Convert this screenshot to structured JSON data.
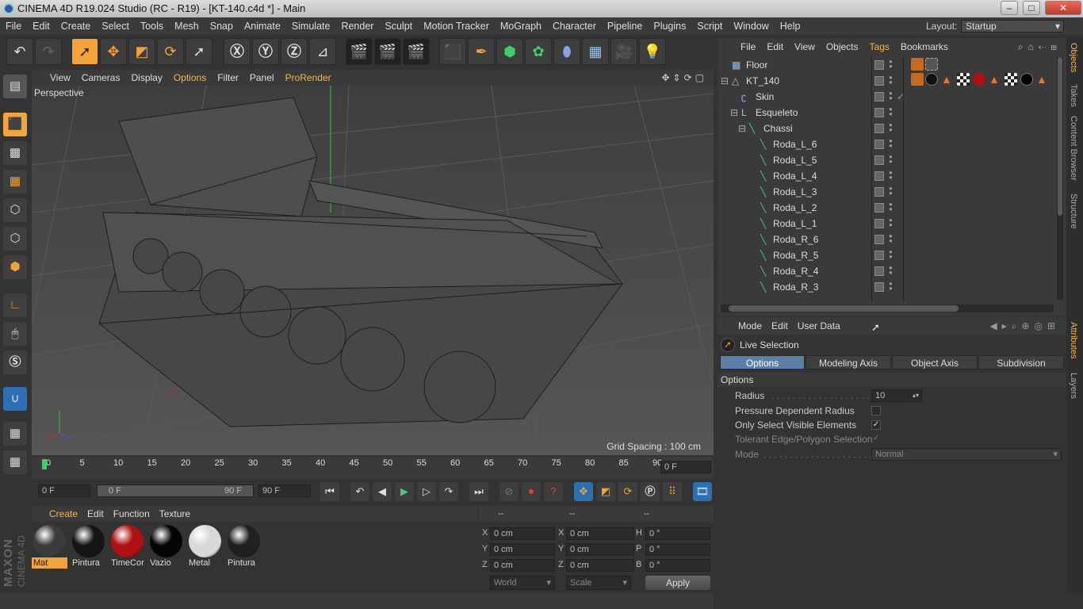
{
  "window": {
    "title": "CINEMA 4D R19.024 Studio (RC - R19) - [KT-140.c4d *] - Main",
    "minimize": "–",
    "maximize": "□",
    "close": "✕"
  },
  "menubar": {
    "items": [
      "File",
      "Edit",
      "Create",
      "Select",
      "Tools",
      "Mesh",
      "Snap",
      "Animate",
      "Simulate",
      "Render",
      "Sculpt",
      "Motion Tracker",
      "MoGraph",
      "Character",
      "Pipeline",
      "Plugins",
      "Script",
      "Window",
      "Help"
    ],
    "layout_label": "Layout:",
    "layout_value": "Startup"
  },
  "viewport": {
    "menu": [
      "View",
      "Cameras",
      "Display",
      "Options",
      "Filter",
      "Panel",
      "ProRender"
    ],
    "active_menu": "Options",
    "label": "Perspective",
    "grid_spacing": "Grid Spacing : 100 cm"
  },
  "timeline": {
    "ticks": [
      "0",
      "5",
      "10",
      "15",
      "20",
      "25",
      "30",
      "35",
      "40",
      "45",
      "50",
      "55",
      "60",
      "65",
      "70",
      "75",
      "80",
      "85",
      "90"
    ],
    "current_frame_field": "0 F"
  },
  "transport": {
    "start_field": "0 F",
    "range_start": "0 F",
    "range_end": "90 F",
    "end_field": "90 F"
  },
  "materials": {
    "menu": [
      "Create",
      "Edit",
      "Function",
      "Texture"
    ],
    "items": [
      {
        "name": "Mat",
        "color": "#3c3c3c",
        "selected": true
      },
      {
        "name": "Pintura",
        "color": "#151515"
      },
      {
        "name": "TimeCor",
        "color": "#b01010"
      },
      {
        "name": "Vazio",
        "color": "#050505"
      },
      {
        "name": "Metal",
        "color": "#d8d8d8"
      },
      {
        "name": "Pintura",
        "color": "#202020"
      }
    ]
  },
  "coordinates": {
    "headers": [
      "--",
      "--",
      "--"
    ],
    "rows": [
      {
        "pos_label": "X",
        "pos": "0 cm",
        "size_label": "X",
        "size": "0 cm",
        "rot_label": "H",
        "rot": "0 °"
      },
      {
        "pos_label": "Y",
        "pos": "0 cm",
        "size_label": "Y",
        "size": "0 cm",
        "rot_label": "P",
        "rot": "0 °"
      },
      {
        "pos_label": "Z",
        "pos": "0 cm",
        "size_label": "Z",
        "size": "0 cm",
        "rot_label": "B",
        "rot": "0 °"
      }
    ],
    "space": "World",
    "mode": "Scale",
    "apply": "Apply"
  },
  "brand": {
    "maxon": "MAXON",
    "product": "CINEMA 4D"
  },
  "object_manager": {
    "menu": [
      "File",
      "Edit",
      "View",
      "Objects",
      "Tags",
      "Bookmarks"
    ],
    "active_menu": "Tags",
    "objects": [
      {
        "name": "Floor",
        "icon": "floor-icon"
      },
      {
        "name": "KT_140",
        "icon": "null-icon"
      },
      {
        "name": "Skin",
        "icon": "skin-icon"
      },
      {
        "name": "Esqueleto",
        "icon": "bone-null-icon"
      },
      {
        "name": "Chassi",
        "icon": "joint-icon"
      },
      {
        "name": "Roda_L_6",
        "icon": "joint-icon"
      },
      {
        "name": "Roda_L_5",
        "icon": "joint-icon"
      },
      {
        "name": "Roda_L_4",
        "icon": "joint-icon"
      },
      {
        "name": "Roda_L_3",
        "icon": "joint-icon"
      },
      {
        "name": "Roda_L_2",
        "icon": "joint-icon"
      },
      {
        "name": "Roda_L_1",
        "icon": "joint-icon"
      },
      {
        "name": "Roda_R_6",
        "icon": "joint-icon"
      },
      {
        "name": "Roda_R_5",
        "icon": "joint-icon"
      },
      {
        "name": "Roda_R_4",
        "icon": "joint-icon"
      },
      {
        "name": "Roda_R_3",
        "icon": "joint-icon"
      }
    ]
  },
  "side_tabs": {
    "top": [
      "Objects",
      "Takes",
      "Content Browser",
      "Structure"
    ],
    "bottom": [
      "Attributes",
      "Layers"
    ]
  },
  "attributes": {
    "menu": [
      "Mode",
      "Edit",
      "User Data"
    ],
    "tool_name": "Live Selection",
    "tabs": [
      "Options",
      "Modeling Axis",
      "Object Axis",
      "Subdivision Surface"
    ],
    "active_tab": "Options",
    "section": "Options",
    "radius_label": "Radius",
    "radius_value": "10",
    "pressure_label": "Pressure Dependent Radius",
    "visible_label": "Only Select Visible Elements",
    "tolerant_label": "Tolerant Edge/Polygon Selection",
    "mode_label": "Mode",
    "mode_value": "Normal"
  },
  "colors": {
    "accent": "#f2a33a",
    "active_tab": "#5b7fa8",
    "active_text": "#f5b64c"
  }
}
